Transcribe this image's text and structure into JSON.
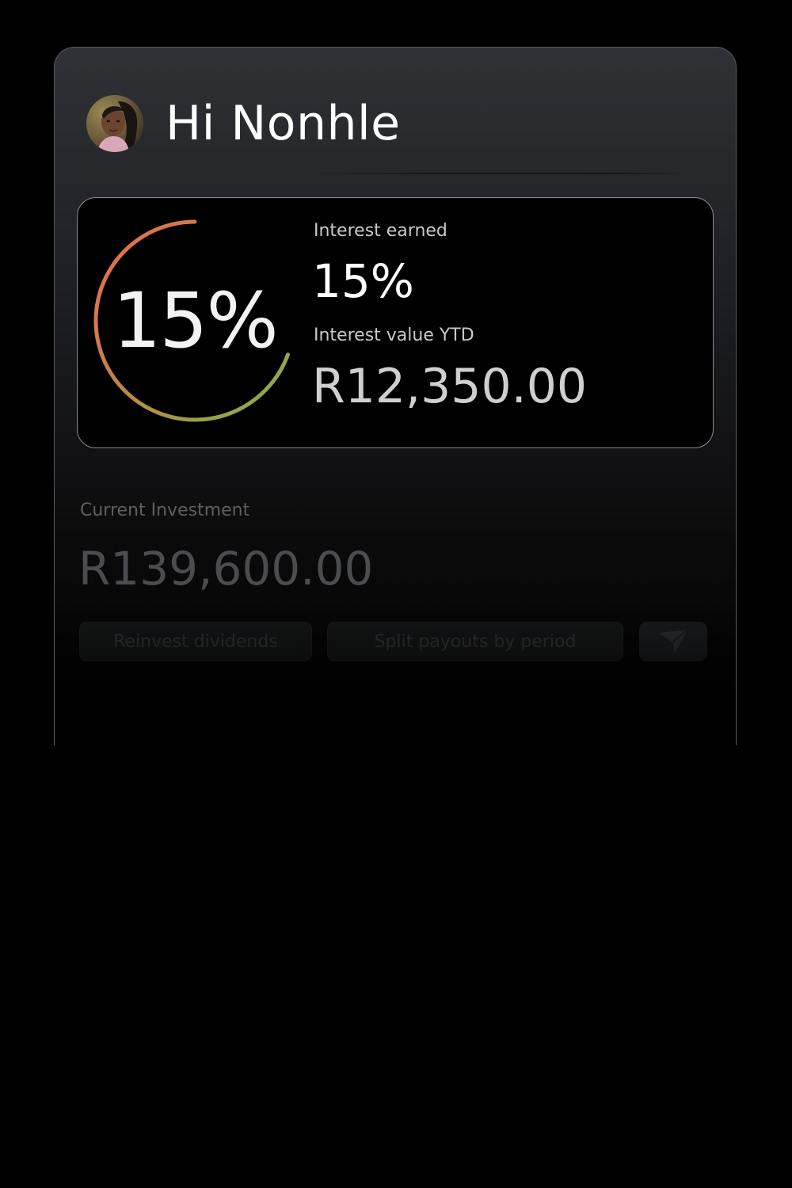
{
  "header": {
    "greeting": "Hi Nonhle"
  },
  "stats": {
    "ring_percent": 15,
    "ring_label": "15%",
    "interest_earned_label": "Interest earned",
    "interest_earned_value": "15%",
    "interest_ytd_label": "Interest value YTD",
    "interest_ytd_value": "R12,350.00"
  },
  "investment": {
    "label": "Current Investment",
    "value": "R139,600.00"
  },
  "actions": {
    "reinvest_label": "Reinvest dividends",
    "split_label": "Split payouts by period"
  },
  "icons": {
    "send": "send-icon",
    "avatar": "avatar"
  },
  "colors": {
    "ring_start": "#ea6a4f",
    "ring_mid": "#b88a4a",
    "ring_end": "#7fb24a",
    "background": "#000000",
    "card_top": "#2f3136"
  }
}
